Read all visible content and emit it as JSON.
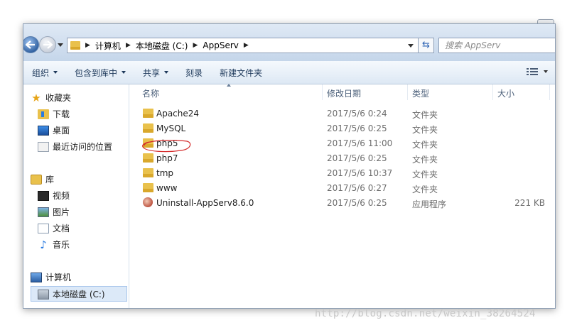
{
  "address_bar": {
    "breadcrumbs": [
      "计算机",
      "本地磁盘 (C:)",
      "AppServ"
    ]
  },
  "search": {
    "placeholder": "搜索 AppServ"
  },
  "toolbar": {
    "organize": "组织",
    "include_in_library": "包含到库中",
    "share": "共享",
    "burn": "刻录",
    "new_folder": "新建文件夹"
  },
  "sidebar": {
    "favorites": {
      "label": "收藏夹",
      "items": [
        "下载",
        "桌面",
        "最近访问的位置"
      ]
    },
    "libraries": {
      "label": "库",
      "items": [
        "视频",
        "图片",
        "文档",
        "音乐"
      ]
    },
    "computer": {
      "label": "计算机",
      "items": [
        "本地磁盘 (C:)"
      ]
    }
  },
  "columns": {
    "name": "名称",
    "date": "修改日期",
    "type": "类型",
    "size": "大小"
  },
  "files": [
    {
      "name": "Apache24",
      "date": "2017/5/6 0:24",
      "type": "文件夹",
      "size": ""
    },
    {
      "name": "MySQL",
      "date": "2017/5/6 0:25",
      "type": "文件夹",
      "size": ""
    },
    {
      "name": "php5",
      "date": "2017/5/6 11:00",
      "type": "文件夹",
      "size": ""
    },
    {
      "name": "php7",
      "date": "2017/5/6 0:25",
      "type": "文件夹",
      "size": ""
    },
    {
      "name": "tmp",
      "date": "2017/5/6 10:37",
      "type": "文件夹",
      "size": ""
    },
    {
      "name": "www",
      "date": "2017/5/6 0:27",
      "type": "文件夹",
      "size": ""
    },
    {
      "name": "Uninstall-AppServ8.6.0",
      "date": "2017/5/6 0:25",
      "type": "应用程序",
      "size": "221 KB"
    }
  ],
  "watermark": "http://blog.csdn.net/weixin_38264524",
  "colors": {
    "annotation_circle": "#d42a2a",
    "folder": "#e9c14c",
    "selection": "#dce9f8"
  },
  "icons": [
    "back-arrow-icon",
    "forward-arrow-icon",
    "folder-icon",
    "refresh-icon",
    "star-icon",
    "music-note-icon",
    "view-options-icon"
  ]
}
